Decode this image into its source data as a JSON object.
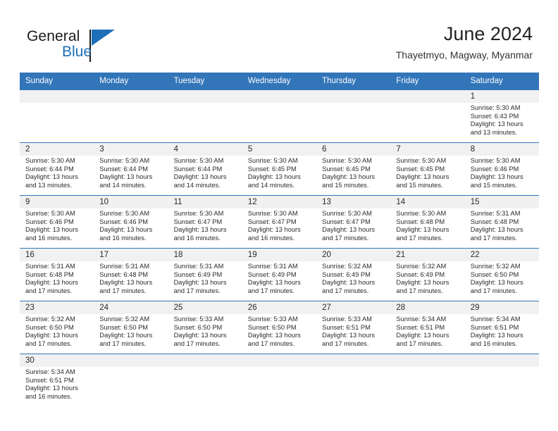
{
  "brand": {
    "word_one": "General",
    "word_two": "Blue",
    "flag_icon": "triangle-flag-icon",
    "accent_color": "#1d6fb8"
  },
  "header": {
    "title": "June 2024",
    "subtitle": "Thayetmyo, Magway, Myanmar"
  },
  "theme": {
    "header_blue": "#3275B9",
    "daynum_band": "#f1f1f1",
    "text": "#2b2b2b"
  },
  "weekdays": [
    "Sunday",
    "Monday",
    "Tuesday",
    "Wednesday",
    "Thursday",
    "Friday",
    "Saturday"
  ],
  "labels": {
    "sunrise": "Sunrise:",
    "sunset": "Sunset:",
    "daylight": "Daylight:"
  },
  "weeks": [
    [
      {
        "day": "",
        "blank": true
      },
      {
        "day": "",
        "blank": true
      },
      {
        "day": "",
        "blank": true
      },
      {
        "day": "",
        "blank": true
      },
      {
        "day": "",
        "blank": true
      },
      {
        "day": "",
        "blank": true
      },
      {
        "day": "1",
        "sunrise": "Sunrise: 5:30 AM",
        "sunset": "Sunset: 6:43 PM",
        "daylight_l1": "Daylight: 13 hours",
        "daylight_l2": "and 13 minutes."
      }
    ],
    [
      {
        "day": "2",
        "sunrise": "Sunrise: 5:30 AM",
        "sunset": "Sunset: 6:44 PM",
        "daylight_l1": "Daylight: 13 hours",
        "daylight_l2": "and 13 minutes."
      },
      {
        "day": "3",
        "sunrise": "Sunrise: 5:30 AM",
        "sunset": "Sunset: 6:44 PM",
        "daylight_l1": "Daylight: 13 hours",
        "daylight_l2": "and 14 minutes."
      },
      {
        "day": "4",
        "sunrise": "Sunrise: 5:30 AM",
        "sunset": "Sunset: 6:44 PM",
        "daylight_l1": "Daylight: 13 hours",
        "daylight_l2": "and 14 minutes."
      },
      {
        "day": "5",
        "sunrise": "Sunrise: 5:30 AM",
        "sunset": "Sunset: 6:45 PM",
        "daylight_l1": "Daylight: 13 hours",
        "daylight_l2": "and 14 minutes."
      },
      {
        "day": "6",
        "sunrise": "Sunrise: 5:30 AM",
        "sunset": "Sunset: 6:45 PM",
        "daylight_l1": "Daylight: 13 hours",
        "daylight_l2": "and 15 minutes."
      },
      {
        "day": "7",
        "sunrise": "Sunrise: 5:30 AM",
        "sunset": "Sunset: 6:45 PM",
        "daylight_l1": "Daylight: 13 hours",
        "daylight_l2": "and 15 minutes."
      },
      {
        "day": "8",
        "sunrise": "Sunrise: 5:30 AM",
        "sunset": "Sunset: 6:46 PM",
        "daylight_l1": "Daylight: 13 hours",
        "daylight_l2": "and 15 minutes."
      }
    ],
    [
      {
        "day": "9",
        "sunrise": "Sunrise: 5:30 AM",
        "sunset": "Sunset: 6:46 PM",
        "daylight_l1": "Daylight: 13 hours",
        "daylight_l2": "and 16 minutes."
      },
      {
        "day": "10",
        "sunrise": "Sunrise: 5:30 AM",
        "sunset": "Sunset: 6:46 PM",
        "daylight_l1": "Daylight: 13 hours",
        "daylight_l2": "and 16 minutes."
      },
      {
        "day": "11",
        "sunrise": "Sunrise: 5:30 AM",
        "sunset": "Sunset: 6:47 PM",
        "daylight_l1": "Daylight: 13 hours",
        "daylight_l2": "and 16 minutes."
      },
      {
        "day": "12",
        "sunrise": "Sunrise: 5:30 AM",
        "sunset": "Sunset: 6:47 PM",
        "daylight_l1": "Daylight: 13 hours",
        "daylight_l2": "and 16 minutes."
      },
      {
        "day": "13",
        "sunrise": "Sunrise: 5:30 AM",
        "sunset": "Sunset: 6:47 PM",
        "daylight_l1": "Daylight: 13 hours",
        "daylight_l2": "and 17 minutes."
      },
      {
        "day": "14",
        "sunrise": "Sunrise: 5:30 AM",
        "sunset": "Sunset: 6:48 PM",
        "daylight_l1": "Daylight: 13 hours",
        "daylight_l2": "and 17 minutes."
      },
      {
        "day": "15",
        "sunrise": "Sunrise: 5:31 AM",
        "sunset": "Sunset: 6:48 PM",
        "daylight_l1": "Daylight: 13 hours",
        "daylight_l2": "and 17 minutes."
      }
    ],
    [
      {
        "day": "16",
        "sunrise": "Sunrise: 5:31 AM",
        "sunset": "Sunset: 6:48 PM",
        "daylight_l1": "Daylight: 13 hours",
        "daylight_l2": "and 17 minutes."
      },
      {
        "day": "17",
        "sunrise": "Sunrise: 5:31 AM",
        "sunset": "Sunset: 6:48 PM",
        "daylight_l1": "Daylight: 13 hours",
        "daylight_l2": "and 17 minutes."
      },
      {
        "day": "18",
        "sunrise": "Sunrise: 5:31 AM",
        "sunset": "Sunset: 6:49 PM",
        "daylight_l1": "Daylight: 13 hours",
        "daylight_l2": "and 17 minutes."
      },
      {
        "day": "19",
        "sunrise": "Sunrise: 5:31 AM",
        "sunset": "Sunset: 6:49 PM",
        "daylight_l1": "Daylight: 13 hours",
        "daylight_l2": "and 17 minutes."
      },
      {
        "day": "20",
        "sunrise": "Sunrise: 5:32 AM",
        "sunset": "Sunset: 6:49 PM",
        "daylight_l1": "Daylight: 13 hours",
        "daylight_l2": "and 17 minutes."
      },
      {
        "day": "21",
        "sunrise": "Sunrise: 5:32 AM",
        "sunset": "Sunset: 6:49 PM",
        "daylight_l1": "Daylight: 13 hours",
        "daylight_l2": "and 17 minutes."
      },
      {
        "day": "22",
        "sunrise": "Sunrise: 5:32 AM",
        "sunset": "Sunset: 6:50 PM",
        "daylight_l1": "Daylight: 13 hours",
        "daylight_l2": "and 17 minutes."
      }
    ],
    [
      {
        "day": "23",
        "sunrise": "Sunrise: 5:32 AM",
        "sunset": "Sunset: 6:50 PM",
        "daylight_l1": "Daylight: 13 hours",
        "daylight_l2": "and 17 minutes."
      },
      {
        "day": "24",
        "sunrise": "Sunrise: 5:32 AM",
        "sunset": "Sunset: 6:50 PM",
        "daylight_l1": "Daylight: 13 hours",
        "daylight_l2": "and 17 minutes."
      },
      {
        "day": "25",
        "sunrise": "Sunrise: 5:33 AM",
        "sunset": "Sunset: 6:50 PM",
        "daylight_l1": "Daylight: 13 hours",
        "daylight_l2": "and 17 minutes."
      },
      {
        "day": "26",
        "sunrise": "Sunrise: 5:33 AM",
        "sunset": "Sunset: 6:50 PM",
        "daylight_l1": "Daylight: 13 hours",
        "daylight_l2": "and 17 minutes."
      },
      {
        "day": "27",
        "sunrise": "Sunrise: 5:33 AM",
        "sunset": "Sunset: 6:51 PM",
        "daylight_l1": "Daylight: 13 hours",
        "daylight_l2": "and 17 minutes."
      },
      {
        "day": "28",
        "sunrise": "Sunrise: 5:34 AM",
        "sunset": "Sunset: 6:51 PM",
        "daylight_l1": "Daylight: 13 hours",
        "daylight_l2": "and 17 minutes."
      },
      {
        "day": "29",
        "sunrise": "Sunrise: 5:34 AM",
        "sunset": "Sunset: 6:51 PM",
        "daylight_l1": "Daylight: 13 hours",
        "daylight_l2": "and 16 minutes."
      }
    ],
    [
      {
        "day": "30",
        "sunrise": "Sunrise: 5:34 AM",
        "sunset": "Sunset: 6:51 PM",
        "daylight_l1": "Daylight: 13 hours",
        "daylight_l2": "and 16 minutes."
      },
      {
        "day": "",
        "blank": true
      },
      {
        "day": "",
        "blank": true
      },
      {
        "day": "",
        "blank": true
      },
      {
        "day": "",
        "blank": true
      },
      {
        "day": "",
        "blank": true
      },
      {
        "day": "",
        "blank": true
      }
    ]
  ]
}
